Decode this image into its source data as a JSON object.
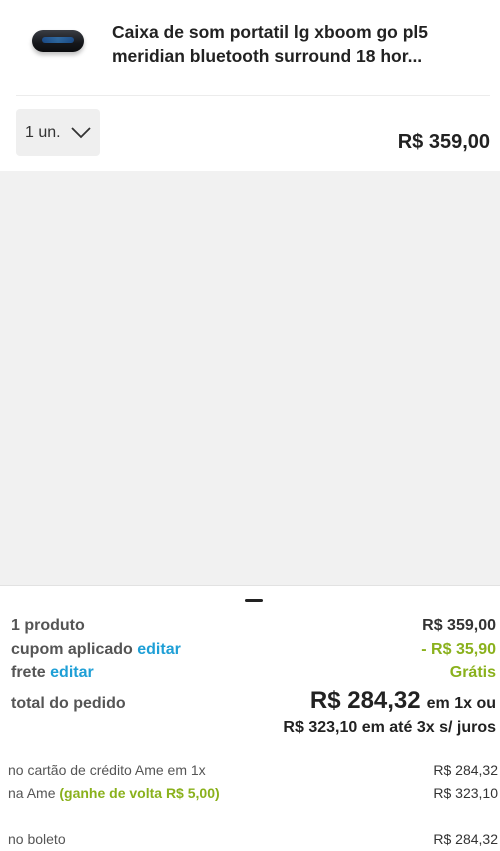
{
  "product": {
    "title": "Caixa de som portatil lg xboom go pl5 meridian bluetooth surround 18 hor...",
    "image_icon": "speaker-image",
    "quantity_label": "1 un.",
    "price": "R$ 359,00"
  },
  "summary": {
    "products_label": "1 produto",
    "products_value": "R$ 359,00",
    "coupon_label": "cupom aplicado",
    "coupon_edit": "editar",
    "coupon_value": "- R$ 35,90",
    "shipping_label": "frete",
    "shipping_edit": "editar",
    "shipping_value": "Grátis",
    "total_label": "total do pedido",
    "total_value": "R$ 284,32",
    "total_suffix": "em 1x ou",
    "installments": "R$ 323,10 em até 3x s/ juros"
  },
  "payment": {
    "ame_card_label": "no cartão de crédito Ame em 1x",
    "ame_card_value": "R$ 284,32",
    "ame_label": "na Ame",
    "ame_cashback": "(ganhe de volta R$ 5,00)",
    "ame_value": "R$ 323,10",
    "boleto_label": "no boleto",
    "boleto_value": "R$ 284,32"
  },
  "colors": {
    "accent_link": "#1e9fd6",
    "discount_green": "#8ab11c",
    "background_gray": "#f1f1f1"
  }
}
